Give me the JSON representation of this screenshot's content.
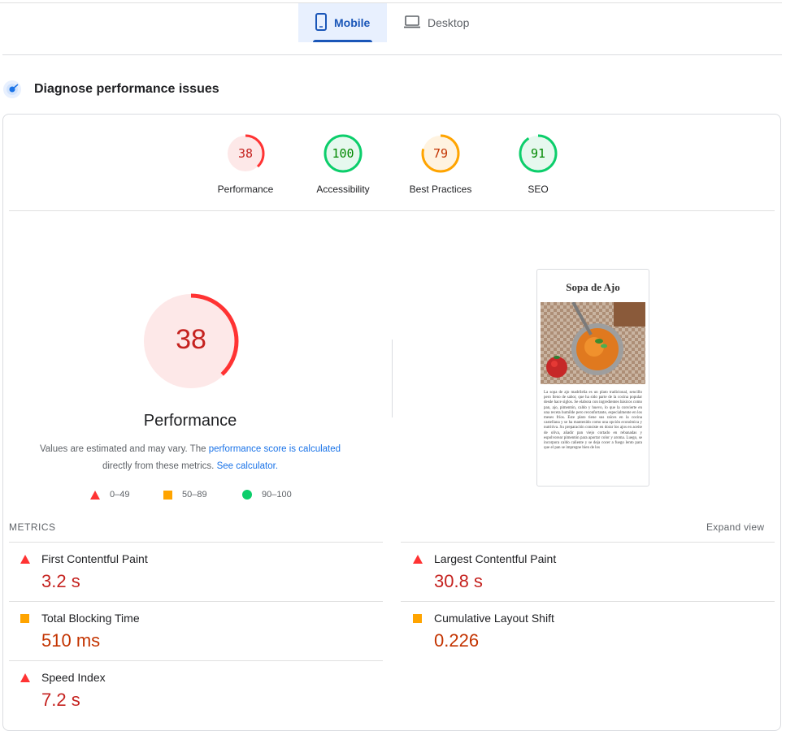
{
  "tabs": [
    {
      "label": "Mobile",
      "icon": "smartphone-icon",
      "active": true
    },
    {
      "label": "Desktop",
      "icon": "laptop-icon",
      "active": false
    }
  ],
  "section_title": "Diagnose performance issues",
  "scores": [
    {
      "value": "38",
      "label": "Performance",
      "fraction": 0.38,
      "status": "fail"
    },
    {
      "value": "100",
      "label": "Accessibility",
      "fraction": 1.0,
      "status": "pass"
    },
    {
      "value": "79",
      "label": "Best Practices",
      "fraction": 0.79,
      "status": "average"
    },
    {
      "value": "91",
      "label": "SEO",
      "fraction": 0.91,
      "status": "pass"
    }
  ],
  "main_gauge": {
    "value": "38",
    "label": "Performance",
    "fraction": 0.38
  },
  "description": {
    "prefix": "Values are estimated and may vary. The ",
    "link1": "performance score is calculated",
    "middle": " directly from these metrics. ",
    "link2": "See calculator.",
    "suffix": ""
  },
  "legend": [
    {
      "range": "0–49",
      "shape": "triangle",
      "color": "#ff3333"
    },
    {
      "range": "50–89",
      "shape": "square",
      "color": "#ffa400"
    },
    {
      "range": "90–100",
      "shape": "circle",
      "color": "#0cce6b"
    }
  ],
  "screenshot": {
    "title": "Sopa de Ajo",
    "text": "La sopa de ajo madrileña es un plato tradicional, sencillo pero lleno de sabor, que ha sido parte de la cocina popular desde hace siglos. Se elabora con ingredientes básicos como pan, ajo, pimentón, caldo y huevo, lo que la convierte en una receta humilde pero reconfortante, especialmente en los meses fríos. Este plato tiene sus raíces en la cocina castellana y se ha mantenido como una opción económica y nutritiva. Su preparación consiste en dorar los ajos en aceite de oliva, añadir pan viejo cortado en rebanadas y espolvorear pimentón para aportar color y aroma. Luego, se incorpora caldo caliente y se deja cocer a fuego lento para que el pan se impregne bien de los"
  },
  "metrics_header": "METRICS",
  "expand_label": "Expand view",
  "metrics": [
    {
      "name": "First Contentful Paint",
      "value": "3.2 s",
      "status": "fail"
    },
    {
      "name": "Largest Contentful Paint",
      "value": "30.8 s",
      "status": "fail"
    },
    {
      "name": "Total Blocking Time",
      "value": "510 ms",
      "status": "average"
    },
    {
      "name": "Cumulative Layout Shift",
      "value": "0.226",
      "status": "average"
    },
    {
      "name": "Speed Index",
      "value": "7.2 s",
      "status": "fail"
    }
  ],
  "colors": {
    "fail": "#ff3333",
    "fail_text": "#c5221f",
    "fail_bg": "#fde8e8",
    "average": "#ffa400",
    "average_text": "#c33300",
    "average_bg": "#fff3e0",
    "pass": "#0cce6b",
    "pass_text": "#008800",
    "pass_bg": "#e6f8ee",
    "accent": "#1a73e8"
  }
}
